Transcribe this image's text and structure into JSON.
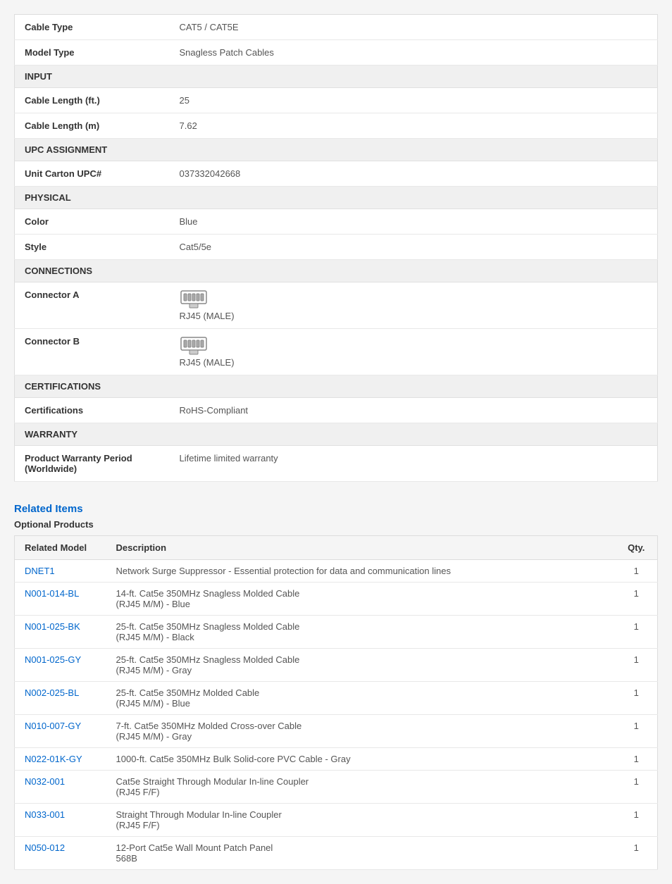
{
  "specs": {
    "rows": [
      {
        "type": "data",
        "label": "Cable Type",
        "value": "CAT5 / CAT5E"
      },
      {
        "type": "data",
        "label": "Model Type",
        "value": "Snagless Patch Cables"
      },
      {
        "type": "section",
        "label": "INPUT"
      },
      {
        "type": "data",
        "label": "Cable Length (ft.)",
        "value": "25"
      },
      {
        "type": "data",
        "label": "Cable Length (m)",
        "value": "7.62"
      },
      {
        "type": "section",
        "label": "UPC ASSIGNMENT"
      },
      {
        "type": "data",
        "label": "Unit Carton UPC#",
        "value": "037332042668"
      },
      {
        "type": "section",
        "label": "PHYSICAL"
      },
      {
        "type": "data",
        "label": "Color",
        "value": "Blue"
      },
      {
        "type": "data",
        "label": "Style",
        "value": "Cat5/5e"
      },
      {
        "type": "section",
        "label": "CONNECTIONS"
      },
      {
        "type": "connector",
        "label": "Connector A",
        "value": "RJ45 (MALE)"
      },
      {
        "type": "connector",
        "label": "Connector B",
        "value": "RJ45 (MALE)"
      },
      {
        "type": "section",
        "label": "CERTIFICATIONS"
      },
      {
        "type": "data",
        "label": "Certifications",
        "value": "RoHS-Compliant"
      },
      {
        "type": "section",
        "label": "WARRANTY"
      },
      {
        "type": "data",
        "label": "Product Warranty Period\n(Worldwide)",
        "value": "Lifetime limited warranty"
      }
    ]
  },
  "related": {
    "title": "Related Items",
    "optional_label": "Optional Products",
    "col_model": "Related Model",
    "col_desc": "Description",
    "col_qty": "Qty.",
    "items": [
      {
        "model": "DNET1",
        "desc": "Network Surge Suppressor - Essential protection for data and communication lines",
        "qty": "1"
      },
      {
        "model": "N001-014-BL",
        "desc": "14-ft. Cat5e 350MHz Snagless Molded Cable\n(RJ45 M/M) - Blue",
        "qty": "1"
      },
      {
        "model": "N001-025-BK",
        "desc": "25-ft. Cat5e 350MHz Snagless Molded Cable\n(RJ45 M/M) - Black",
        "qty": "1"
      },
      {
        "model": "N001-025-GY",
        "desc": "25-ft. Cat5e 350MHz Snagless Molded Cable\n(RJ45 M/M) - Gray",
        "qty": "1"
      },
      {
        "model": "N002-025-BL",
        "desc": "25-ft. Cat5e 350MHz Molded Cable\n(RJ45 M/M) - Blue",
        "qty": "1"
      },
      {
        "model": "N010-007-GY",
        "desc": "7-ft. Cat5e 350MHz Molded Cross-over Cable\n(RJ45 M/M) - Gray",
        "qty": "1"
      },
      {
        "model": "N022-01K-GY",
        "desc": "1000-ft. Cat5e 350MHz Bulk Solid-core PVC Cable - Gray",
        "qty": "1"
      },
      {
        "model": "N032-001",
        "desc": "Cat5e Straight Through Modular In-line Coupler\n(RJ45 F/F)",
        "qty": "1"
      },
      {
        "model": "N033-001",
        "desc": "Straight Through Modular In-line Coupler\n(RJ45 F/F)",
        "qty": "1"
      },
      {
        "model": "N050-012",
        "desc": "12-Port Cat5e Wall Mount Patch Panel\n568B",
        "qty": "1"
      }
    ]
  }
}
